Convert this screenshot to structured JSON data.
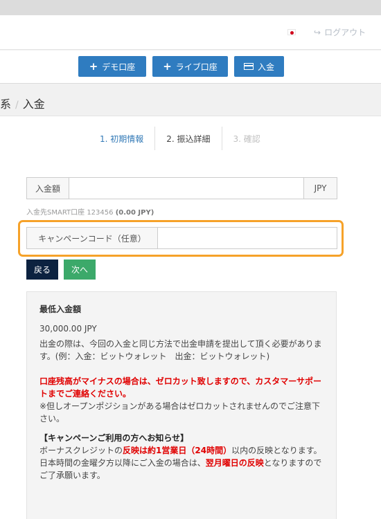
{
  "header": {
    "logout_label": "ログアウト"
  },
  "actions": {
    "demo_label": "デモ口座",
    "live_label": "ライブ口座",
    "deposit_label": "入金"
  },
  "breadcrumb": {
    "parent": "系",
    "current": "入金"
  },
  "steps": [
    {
      "label": "1. 初期情報"
    },
    {
      "label": "2. 振込詳細"
    },
    {
      "label": "3. 確認"
    }
  ],
  "form": {
    "amount_label": "入金額",
    "currency": "JPY",
    "help_prefix": "入金先SMART口座 123456",
    "help_balance": "(0.00 JPY)",
    "campaign_label": "キャンペーンコード（任意）",
    "back_label": "戻る",
    "next_label": "次へ"
  },
  "notice": {
    "min_title": "最低入金額",
    "min_value": "30,000.00 JPY",
    "p1": "出金の際は、今回の入金と同じ方法で出金申請を提出して頂く必要があります。(例：入金：ビットウォレット　出金：ビットウォレット)",
    "p2_red": "口座残高がマイナスの場合は、ゼロカット致しますので、カスタマーサポートまでご連絡ください。",
    "p2_tail": "※但しオープンポジションがある場合はゼロカットされませんのでご注意下さい。",
    "campaign_title": "【キャンペーンご利用の方へお知らせ】",
    "p3_a": "ボーナスクレジットの",
    "p3_red": "反映は約1営業日（24時間）",
    "p3_b": "以内の反映となります。",
    "p4_a": "日本時間の金曜夕方以降にご入金の場合は、",
    "p4_red": "翌月曜日の反映",
    "p4_b": "となりますのでご了承願います。"
  }
}
